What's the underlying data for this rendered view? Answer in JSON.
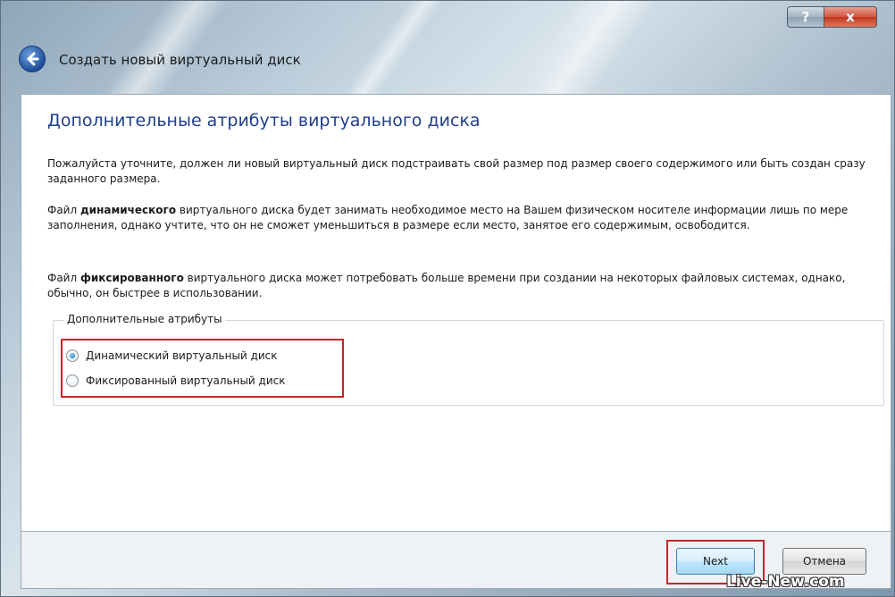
{
  "window": {
    "title": "Создать новый виртуальный диск",
    "help_label": "?",
    "close_label": "x"
  },
  "page": {
    "heading": "Дополнительные атрибуты виртуального диска",
    "paragraph1": "Пожалуйста уточните, должен ли новый виртуальный диск подстраивать свой размер под размер своего содержимого или быть создан сразу заданного размера.",
    "paragraph2": {
      "prefix": "Файл ",
      "bold": "динамического",
      "suffix": " виртуального диска будет занимать необходимое место на Вашем физическом носителе информации лишь по мере заполнения, однако учтите, что он не сможет уменьшиться в размере если место, занятое его содержимым, освободится."
    },
    "paragraph3": {
      "prefix": "Файл ",
      "bold": "фиксированного",
      "suffix": " виртуального диска может потребовать больше времени при создании на некоторых файловых системах, однако, обычно, он быстрее в использовании."
    }
  },
  "options": {
    "group_label": "Дополнительные атрибуты",
    "items": [
      {
        "label": "Динамический виртуальный диск",
        "selected": true
      },
      {
        "label": "Фиксированный виртуальный диск",
        "selected": false
      }
    ]
  },
  "buttons": {
    "next": "Next",
    "cancel": "Отмена"
  },
  "watermark": "Live-New.com",
  "colors": {
    "heading": "#1e3f8a",
    "highlight": "#c4262a"
  }
}
